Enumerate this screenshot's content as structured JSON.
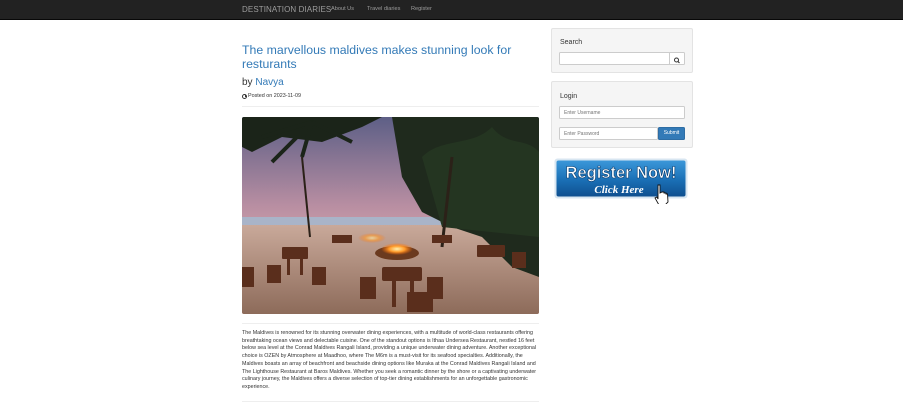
{
  "navbar": {
    "brand": "DESTINATION DIARIES",
    "links": [
      "About Us",
      "Travel diaries",
      "Register"
    ]
  },
  "post": {
    "title": "The marvellous maldives makes stunning look for resturants",
    "by": "by",
    "author": "Navya",
    "posted": "Posted on 2023-11-09",
    "body": "The Maldives is renowned for its stunning overwater dining experiences, with a multitude of world-class restaurants offering breathtaking ocean views and delectable cuisine. One of the standout options is Ithaa Undersea Restaurant, nestled 16 feet below sea level at the Conrad Maldives Rangali Island, providing a unique underwater dining adventure. Another exceptional choice is OZEN by Atmosphere at Maadhoo, where The M6m is a must-visit for its seafood specialties. Additionally, the Maldives boasts an array of beachfront and beachside dining options like Muraka at the Conrad Maldives Rangali Island and The Lighthouse Restaurant at Baros Maldives. Whether you seek a romantic dinner by the shore or a captivating underwater culinary journey, the Maldives offers a diverse selection of top-tier dining establishments for an unforgettable gastronomic experience."
  },
  "sidebar": {
    "search": {
      "title": "Search",
      "placeholder": ""
    },
    "login": {
      "title": "Login",
      "username_placeholder": "Enter Username",
      "password_placeholder": "Enter Password",
      "submit_label": "Submit"
    },
    "banner": {
      "line1": "Register Now!",
      "line2": "Click Here"
    }
  },
  "colors": {
    "navbar": "#222222",
    "link": "#337ab7",
    "button": "#337ab7",
    "banner": "#1a6fb5"
  },
  "icons": [
    "search-icon",
    "clock-icon",
    "cursor-hand-icon"
  ]
}
